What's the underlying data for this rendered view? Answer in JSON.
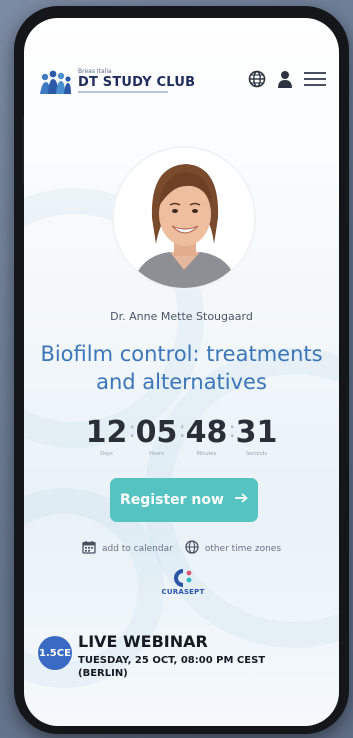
{
  "header": {
    "brand_line": "Breas Italia",
    "logo_title": "DT STUDY CLUB",
    "icons": [
      "globe-icon",
      "user-icon",
      "menu-icon"
    ]
  },
  "speaker": {
    "name": "Dr. Anne Mette Stougaard"
  },
  "webinar": {
    "title": "Biofilm control: treatments and alternatives"
  },
  "countdown": {
    "days": "12",
    "days_label": "Days",
    "hours": "05",
    "hours_label": "Hours",
    "minutes": "48",
    "minutes_label": "Minutes",
    "seconds": "31",
    "seconds_label": "Seconds"
  },
  "actions": {
    "register_label": "Register now",
    "add_calendar_label": "add to calendar",
    "time_zones_label": "other time zones"
  },
  "sponsor": {
    "name": "CURASEPT"
  },
  "event": {
    "ce_badge": "1.5CE",
    "type": "LIVE WEBINAR",
    "datetime": "TUESDAY, 25 OCT, 08:00 PM CEST (BERLIN)"
  },
  "colors": {
    "accent_blue": "#3a76b8",
    "button_teal": "#56c3c3",
    "badge_blue": "#3a6bc4",
    "logo_navy": "#1f2d5c"
  }
}
